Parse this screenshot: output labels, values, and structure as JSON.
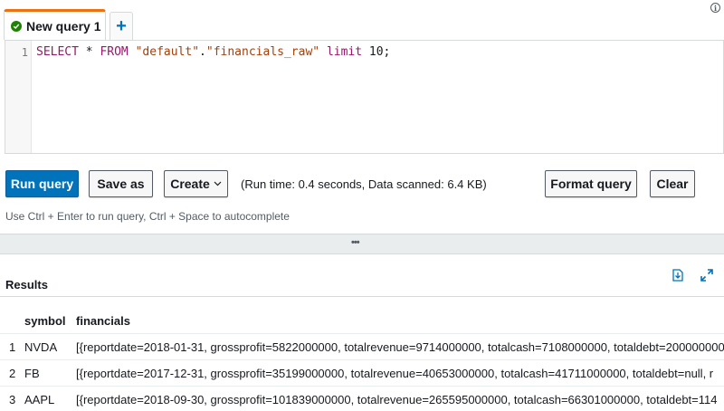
{
  "tabs": {
    "active_label": "New query 1",
    "add_label": "+"
  },
  "editor": {
    "line_number": "1",
    "code": {
      "kw_select": "SELECT",
      "star": " * ",
      "kw_from": "FROM",
      "sp1": " ",
      "str_db": "\"default\"",
      "dot": ".",
      "str_table": "\"financials_raw\"",
      "sp2": " ",
      "kw_limit": "limit",
      "num": " 10;"
    }
  },
  "toolbar": {
    "run_label": "Run query",
    "save_as_label": "Save as",
    "create_label": "Create",
    "run_info": "(Run time: 0.4 seconds, Data scanned: 6.4 KB)",
    "format_label": "Format query",
    "clear_label": "Clear",
    "hint": "Use Ctrl + Enter to run query, Ctrl + Space to autocomplete"
  },
  "splitter": {
    "handle": "•••"
  },
  "results": {
    "title": "Results",
    "columns": [
      "symbol",
      "financials"
    ],
    "rows": [
      {
        "index": "1",
        "symbol": "NVDA",
        "financials": "[{reportdate=2018-01-31, grossprofit=5822000000, totalrevenue=9714000000, totalcash=7108000000, totaldebt=2000000000"
      },
      {
        "index": "2",
        "symbol": "FB",
        "financials": "[{reportdate=2017-12-31, grossprofit=35199000000, totalrevenue=40653000000, totalcash=41711000000, totaldebt=null, r"
      },
      {
        "index": "3",
        "symbol": "AAPL",
        "financials": "[{reportdate=2018-09-30, grossprofit=101839000000, totalrevenue=265595000000, totalcash=66301000000, totaldebt=114"
      }
    ]
  },
  "colors": {
    "primary": "#0073bb",
    "tab_accent": "#ec7211",
    "success": "#1d8102"
  },
  "icons": {
    "tab_status": "check-circle-icon",
    "info": "info-icon",
    "download": "download-icon",
    "expand": "expand-icon"
  }
}
